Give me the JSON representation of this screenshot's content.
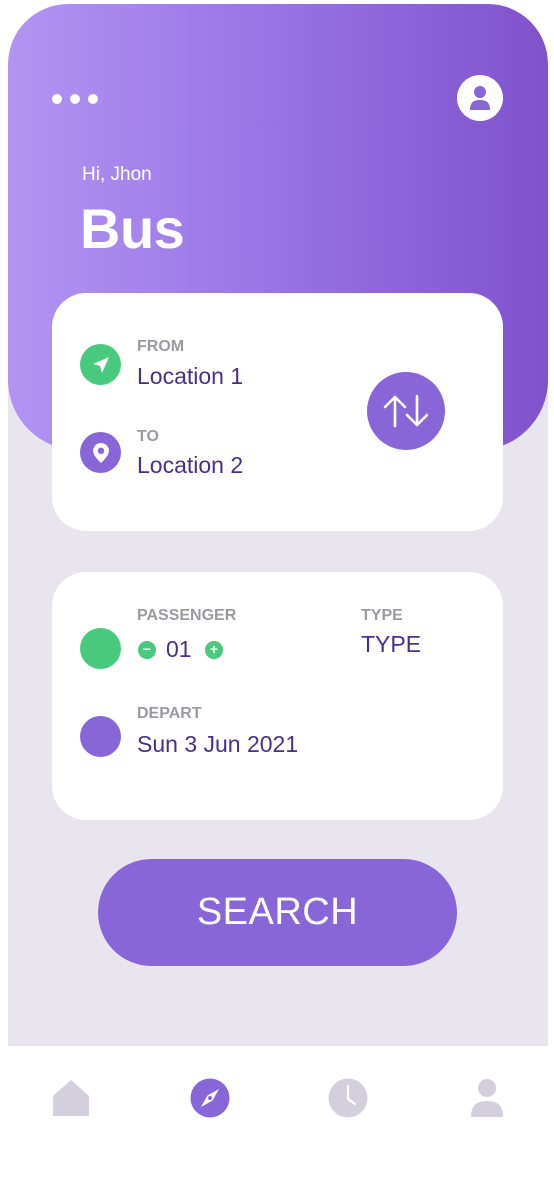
{
  "header": {
    "greeting": "Hi, Jhon",
    "title": "Bus",
    "menu_icon": "more-dots-icon",
    "profile_icon": "user-icon"
  },
  "route": {
    "from_label": "FROM",
    "from_value": "Location 1",
    "to_label": "TO",
    "to_value": "Location 2",
    "swap_icon": "swap-arrows-icon"
  },
  "details": {
    "passenger_label": "PASSENGER",
    "passenger_count": "01",
    "type_label": "TYPE",
    "type_value": "TYPE",
    "depart_label": "DEPART",
    "depart_value": "Sun 3 Jun 2021",
    "minus_symbol": "−",
    "plus_symbol": "+"
  },
  "search_label": "SEARCH",
  "nav": {
    "items": [
      "home-icon",
      "compass-icon",
      "clock-icon",
      "profile-icon"
    ],
    "active": "compass-icon"
  },
  "colors": {
    "accent": "#8866d8",
    "green": "#49c97d",
    "text_dark": "#4a2f8a",
    "label_gray": "#9a9aa2",
    "nav_inactive": "#d3cfdc",
    "background": "#e8e5ee"
  }
}
